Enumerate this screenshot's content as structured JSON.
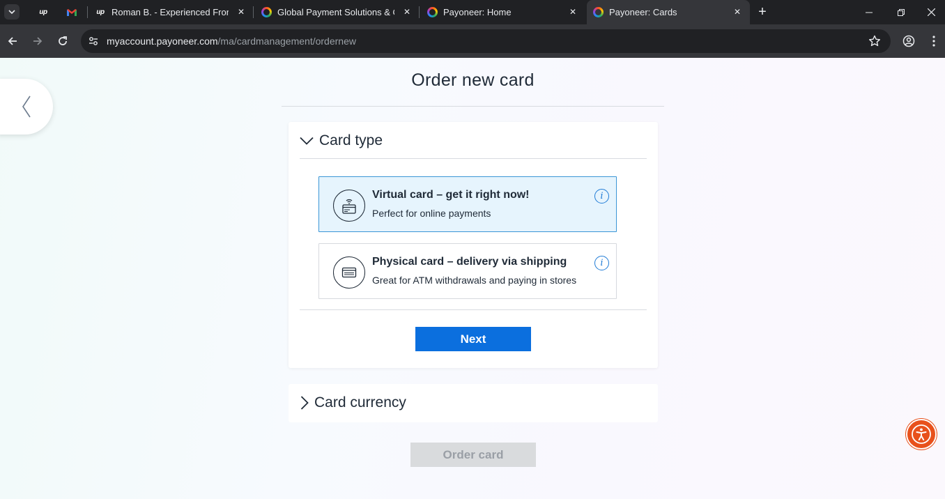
{
  "browser": {
    "tabs": [
      {
        "title": "",
        "favicon": "upwork-icon"
      },
      {
        "title": "",
        "favicon": "gmail-icon"
      },
      {
        "title": "Roman B. - Experienced Fronter",
        "favicon": "upwork-icon"
      },
      {
        "title": "Global Payment Solutions & On",
        "favicon": "payoneer-icon"
      },
      {
        "title": "Payoneer: Home",
        "favicon": "payoneer-icon"
      },
      {
        "title": "Payoneer: Cards",
        "favicon": "payoneer-icon",
        "active": true
      }
    ],
    "url_host": "myaccount.payoneer.com",
    "url_path": "/ma/cardmanagement/ordernew"
  },
  "page": {
    "title": "Order new card",
    "card_type": {
      "heading": "Card type",
      "options": [
        {
          "title": "Virtual card – get it right now!",
          "description": "Perfect for online payments",
          "selected": true,
          "icon": "virtual-card-icon"
        },
        {
          "title": "Physical card – delivery via shipping",
          "description": "Great for ATM withdrawals and paying in stores",
          "selected": false,
          "icon": "physical-card-icon"
        }
      ],
      "info_glyph": "i",
      "next_label": "Next"
    },
    "card_currency": {
      "heading": "Card currency"
    },
    "order_label": "Order card"
  },
  "colors": {
    "primary": "#0b6fde",
    "selected_bg": "#e6f4fd",
    "selected_border": "#3a95d6",
    "accessibility": "#e8511c"
  }
}
